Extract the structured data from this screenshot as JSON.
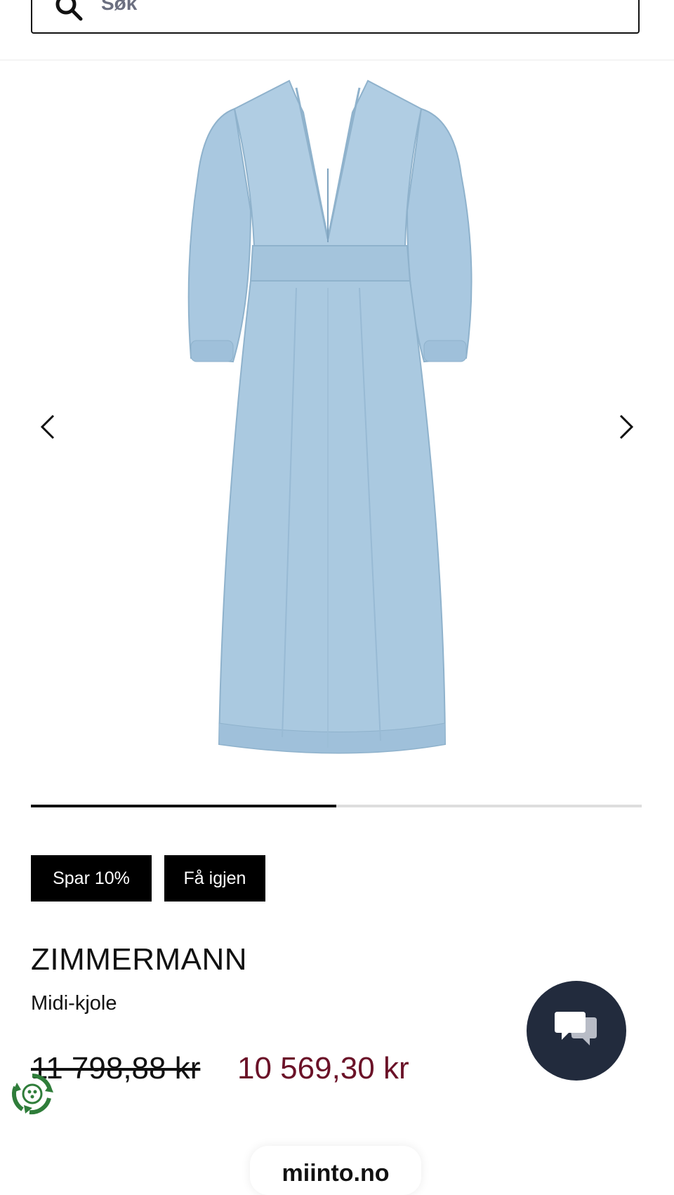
{
  "search": {
    "placeholder": "Søk",
    "icon": "search-icon"
  },
  "gallery": {
    "image_alt": "Denim midi dress",
    "prev_icon": "chevron-left-icon",
    "next_icon": "chevron-right-icon",
    "progress_fraction": 0.5
  },
  "tags": {
    "save": "Spar 10%",
    "restock": "Få igjen"
  },
  "product": {
    "brand": "ZIMMERMANN",
    "name": "Midi-kjole",
    "price_original": "11 798,88 kr",
    "price_current": "10 569,30 kr"
  },
  "chat": {
    "icon": "chat-bubbles-icon"
  },
  "eco": {
    "icon": "recycle-badge-icon"
  },
  "footer": {
    "site": "miinto.no"
  },
  "colors": {
    "sale_price": "#6b1228",
    "chat_bg": "#222b3d",
    "tag_bg": "#000000",
    "eco_green": "#2f7d3a",
    "denim": "#a9c8e0"
  }
}
